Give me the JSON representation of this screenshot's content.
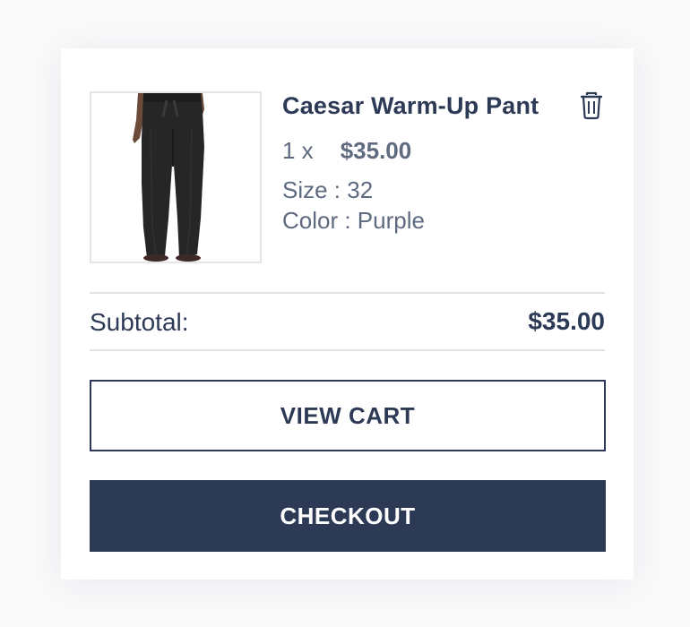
{
  "item": {
    "name": "Caesar Warm-Up Pant",
    "quantity_text": "1 x",
    "price": "$35.00",
    "size_text": "Size : 32",
    "color_text": "Color : Purple",
    "image_alt": "Black warm-up pants",
    "remove_icon": "trash-icon"
  },
  "summary": {
    "subtotal_label": "Subtotal:",
    "subtotal_value": "$35.00"
  },
  "actions": {
    "view_cart_label": "VIEW CART",
    "checkout_label": "CHECKOUT"
  },
  "colors": {
    "brand_navy": "#2d3a56",
    "muted_text": "#5e6a80",
    "divider": "#e2e2e2"
  }
}
